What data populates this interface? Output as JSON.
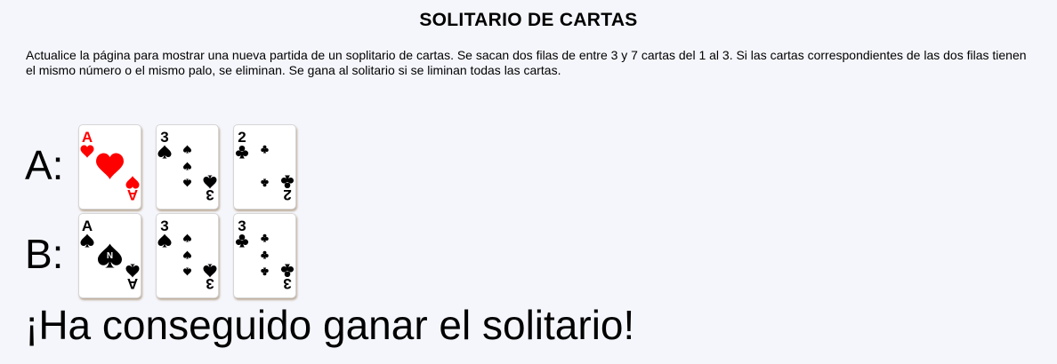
{
  "header": {
    "title": "SOLITARIO DE CARTAS"
  },
  "intro": {
    "text": "Actualice la página para mostrar una nueva partida de un soplitario de cartas. Se sacan dos filas de entre 3 y 7 cartas del 1 al 3. Si las cartas correspondientes de las dos filas tienen el mismo número o el mismo palo, se eliminan. Se gana al solitario si se liminan todas las cartas."
  },
  "rows": [
    {
      "label": "A:",
      "cards": [
        {
          "rank": "A",
          "suit": "hearts",
          "color": "#ff0000"
        },
        {
          "rank": "3",
          "suit": "spades",
          "color": "#000000"
        },
        {
          "rank": "2",
          "suit": "clubs",
          "color": "#000000"
        }
      ]
    },
    {
      "label": "B:",
      "cards": [
        {
          "rank": "A",
          "suit": "spades",
          "color": "#000000"
        },
        {
          "rank": "3",
          "suit": "spades",
          "color": "#000000"
        },
        {
          "rank": "3",
          "suit": "clubs",
          "color": "#000000"
        }
      ]
    }
  ],
  "result": {
    "message": "¡Ha conseguido ganar el solitario!"
  },
  "colors": {
    "background": "#f5f6fb",
    "red_suit": "#ff0000",
    "black_suit": "#000000"
  }
}
